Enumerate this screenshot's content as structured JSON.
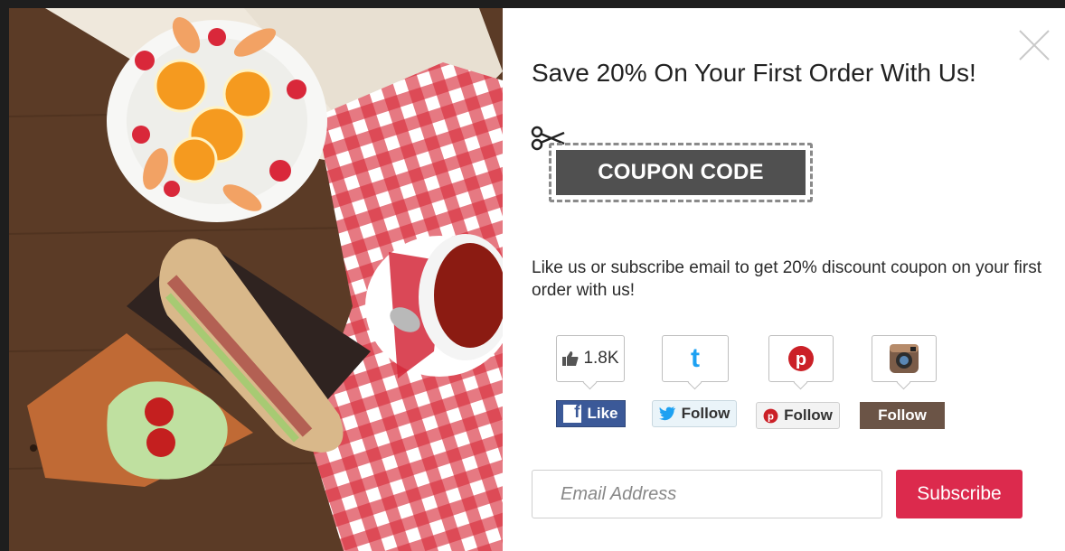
{
  "popup": {
    "headline": "Save 20% On Your First Order With Us!",
    "coupon_label": "COUPON CODE",
    "description": "Like us or subscribe email to get 20% discount coupon on your first order with us!"
  },
  "social": {
    "facebook": {
      "count": "1.8K",
      "button_label": "Like",
      "icon": "thumbs-up-icon",
      "color": "#3b5998"
    },
    "twitter": {
      "button_label": "Follow",
      "icon": "twitter-icon",
      "color": "#1da1f2"
    },
    "pinterest": {
      "button_label": "Follow",
      "icon": "pinterest-icon",
      "color": "#cb2027"
    },
    "instagram": {
      "button_label": "Follow",
      "icon": "instagram-icon",
      "color": "#6b5446"
    }
  },
  "subscribe_form": {
    "email_placeholder": "Email Address",
    "button_label": "Subscribe",
    "button_color": "#dc2a4d"
  },
  "icons": {
    "close": "close-icon",
    "scissors": "scissors-icon"
  }
}
